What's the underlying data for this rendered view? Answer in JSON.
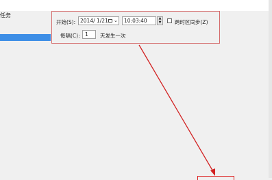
{
  "left": {
    "label": "任务"
  },
  "schedule": {
    "start_label": "开始(S):",
    "date_value": "2014/  1/21",
    "time_value": "10:03:40",
    "sync_label": "跨时区同步(Z)",
    "sync_checked": false,
    "every_label": "每隔(C):",
    "every_value": "1",
    "every_suffix": "天发生一次"
  },
  "icons": {
    "calendar": "calendar-icon",
    "dropdown": "chevron-down-icon",
    "spin": "spinner-icon"
  },
  "colors": {
    "highlight_border": "#d46a6a",
    "arrow": "#d22222",
    "selection": "#3d8ee6"
  }
}
